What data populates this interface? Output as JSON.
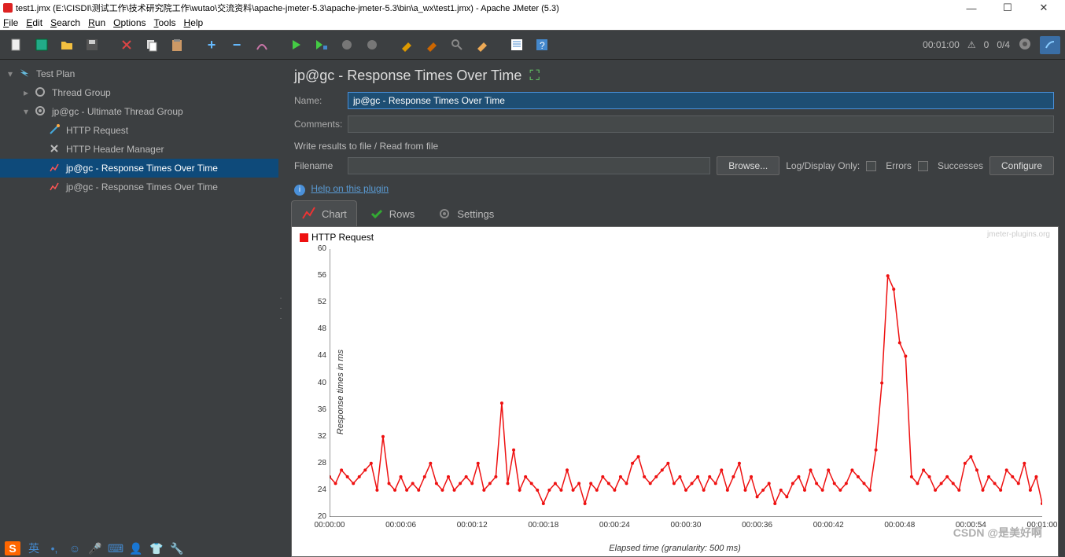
{
  "window": {
    "title": "test1.jmx (E:\\CISDI\\测试工作\\技术研究院工作\\wutao\\交流资料\\apache-jmeter-5.3\\apache-jmeter-5.3\\bin\\a_wx\\test1.jmx) - Apache JMeter (5.3)"
  },
  "menu": [
    "File",
    "Edit",
    "Search",
    "Run",
    "Options",
    "Tools",
    "Help"
  ],
  "toolbar_status": {
    "time": "00:01:00",
    "warn_count": "0",
    "threads": "0/4"
  },
  "tree": {
    "root": "Test Plan",
    "thread_group": "Thread Group",
    "utg": "jp@gc - Ultimate Thread Group",
    "http_req": "HTTP Request",
    "http_hdr": "HTTP Header Manager",
    "rotot1": "jp@gc - Response Times Over Time",
    "rotot2": "jp@gc - Response Times Over Time"
  },
  "panel": {
    "title": "jp@gc - Response Times Over Time",
    "name_label": "Name:",
    "name_value": "jp@gc - Response Times Over Time",
    "comments_label": "Comments:",
    "comments_value": "",
    "fieldset": "Write results to file / Read from file",
    "filename_label": "Filename",
    "filename_value": "",
    "browse": "Browse...",
    "logdisplay": "Log/Display Only:",
    "errors": "Errors",
    "successes": "Successes",
    "configure": "Configure",
    "help": "Help on this plugin",
    "tabs": {
      "chart": "Chart",
      "rows": "Rows",
      "settings": "Settings"
    }
  },
  "legend": {
    "series1": "HTTP Request"
  },
  "watermark": "jmeter-plugins.org",
  "csdn": "CSDN @是美好啊",
  "chart_data": {
    "type": "line",
    "title": "",
    "xlabel": "Elapsed time (granularity: 500 ms)",
    "ylabel": "Response times in ms",
    "ylim": [
      20,
      60
    ],
    "x_ticks": [
      "00:00:00",
      "00:00:06",
      "00:00:12",
      "00:00:18",
      "00:00:24",
      "00:00:30",
      "00:00:36",
      "00:00:42",
      "00:00:48",
      "00:00:54",
      "00:01:00"
    ],
    "y_ticks": [
      20,
      24,
      28,
      32,
      36,
      40,
      44,
      48,
      52,
      56,
      60
    ],
    "series": [
      {
        "name": "HTTP Request",
        "color": "#e11",
        "x": [
          0,
          0.5,
          1,
          1.5,
          2,
          2.5,
          3,
          3.5,
          4,
          4.5,
          5,
          5.5,
          6,
          6.5,
          7,
          7.5,
          8,
          8.5,
          9,
          9.5,
          10,
          10.5,
          11,
          11.5,
          12,
          12.5,
          13,
          13.5,
          14,
          14.5,
          15,
          15.5,
          16,
          16.5,
          17,
          17.5,
          18,
          18.5,
          19,
          19.5,
          20,
          20.5,
          21,
          21.5,
          22,
          22.5,
          23,
          23.5,
          24,
          24.5,
          25,
          25.5,
          26,
          26.5,
          27,
          27.5,
          28,
          28.5,
          29,
          29.5,
          30,
          30.5,
          31,
          31.5,
          32,
          32.5,
          33,
          33.5,
          34,
          34.5,
          35,
          35.5,
          36,
          36.5,
          37,
          37.5,
          38,
          38.5,
          39,
          39.5,
          40,
          40.5,
          41,
          41.5,
          42,
          42.5,
          43,
          43.5,
          44,
          44.5,
          45,
          45.5,
          46,
          46.5,
          47,
          47.5,
          48,
          48.5,
          49,
          49.5,
          50,
          50.5,
          51,
          51.5,
          52,
          52.5,
          53,
          53.5,
          54,
          54.5,
          55,
          55.5,
          56,
          56.5,
          57,
          57.5,
          58,
          58.5,
          59,
          59.5,
          60
        ],
        "values": [
          26,
          25,
          27,
          26,
          25,
          26,
          27,
          28,
          24,
          32,
          25,
          24,
          26,
          24,
          25,
          24,
          26,
          28,
          25,
          24,
          26,
          24,
          25,
          26,
          25,
          28,
          24,
          25,
          26,
          37,
          25,
          30,
          24,
          26,
          25,
          24,
          22,
          24,
          25,
          24,
          27,
          24,
          25,
          22,
          25,
          24,
          26,
          25,
          24,
          26,
          25,
          28,
          29,
          26,
          25,
          26,
          27,
          28,
          25,
          26,
          24,
          25,
          26,
          24,
          26,
          25,
          27,
          24,
          26,
          28,
          24,
          26,
          23,
          24,
          25,
          22,
          24,
          23,
          25,
          26,
          24,
          27,
          25,
          24,
          27,
          25,
          24,
          25,
          27,
          26,
          25,
          24,
          30,
          40,
          56,
          54,
          46,
          44,
          26,
          25,
          27,
          26,
          24,
          25,
          26,
          25,
          24,
          28,
          29,
          27,
          24,
          26,
          25,
          24,
          27,
          26,
          25,
          28,
          24,
          26,
          22
        ]
      }
    ]
  }
}
